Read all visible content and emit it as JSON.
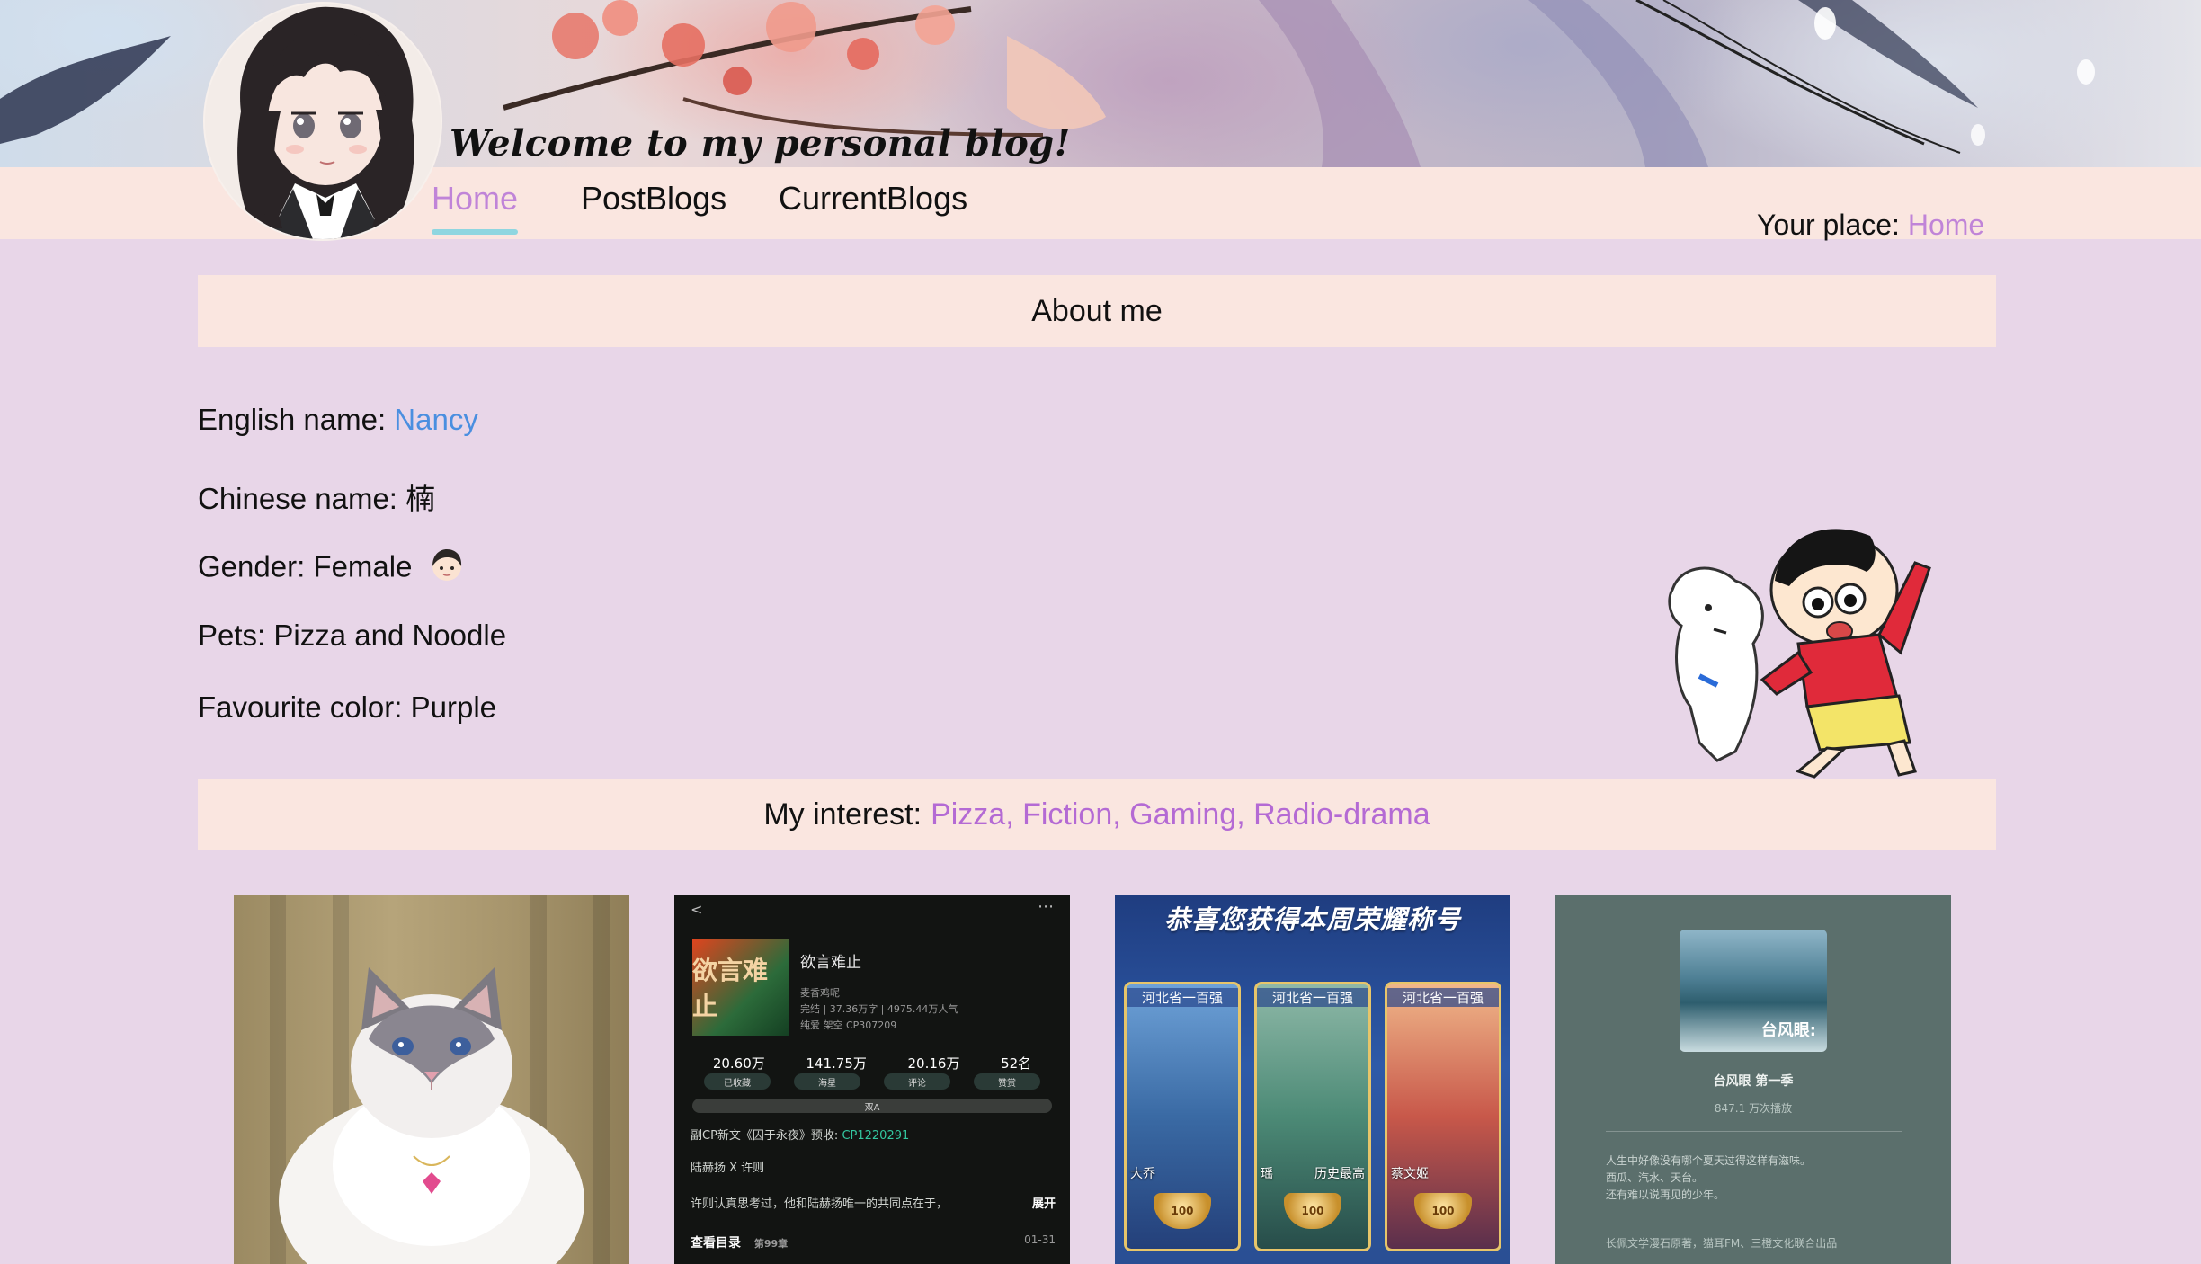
{
  "header": {
    "welcome": "Welcome to my personal blog!"
  },
  "nav": {
    "items": [
      {
        "label": "Home",
        "active": true
      },
      {
        "label": "PostBlogs",
        "active": false
      },
      {
        "label": "CurrentBlogs",
        "active": false
      }
    ],
    "your_place_label": "Your place:",
    "your_place_value": "Home"
  },
  "about": {
    "heading": "About me",
    "fields": [
      {
        "label": "English name:",
        "value": "Nancy"
      },
      {
        "label": "Chinese name:",
        "value": "楠"
      },
      {
        "label": "Gender:",
        "value": "Female"
      },
      {
        "label": "Pets:",
        "value": "Pizza and Noodle"
      },
      {
        "label": "Favourite color:",
        "value": "Purple"
      }
    ]
  },
  "interest": {
    "label": "My interest:",
    "values": "Pizza, Fiction, Gaming, Radio-drama"
  },
  "photos": {
    "novel": {
      "cover_text": "欲言难止",
      "title": "欲言难止",
      "author": "麦香鸡呢",
      "stats1": "完结 | 37.36万字 | 4975.44万人气",
      "stats2": "纯爱 架空 CP307209",
      "nums": [
        "20.60万",
        "141.75万",
        "20.16万",
        "52名"
      ],
      "pills": [
        "已收藏",
        "海星",
        "评论",
        "赞赏"
      ],
      "bar": "双A",
      "line1_prefix": "副CP新文《囚于永夜》预收:",
      "line1_cp": "CP1220291",
      "line2": "陆赫扬 X 许则",
      "line3": "许则认真思考过，他和陆赫扬唯一的共同点在于，",
      "more": "展开",
      "toc": "查看目录",
      "toc_sub": "第99章",
      "date": "01-31",
      "top_left": "<",
      "top_right": "⋯"
    },
    "gaming": {
      "title": "恭喜您获得本周荣耀称号",
      "cards": [
        {
          "label": "河北省一百强",
          "name": "大乔",
          "extra": ""
        },
        {
          "label": "河北省一百强",
          "name": "瑶",
          "extra": "历史最高"
        },
        {
          "label": "河北省一百强",
          "name": "蔡文姬",
          "extra": ""
        }
      ],
      "badge": "100"
    },
    "radio": {
      "cover_text": "台风眼:",
      "title": "台风眼 第一季",
      "plays": "847.1 万次播放",
      "desc_line1": "人生中好像没有哪个夏天过得这样有滋味。",
      "desc_line2": "西瓜、汽水、天台。",
      "desc_line3": "还有难以说再见的少年。",
      "credit": "长佩文学漫石原著，猫耳FM、三橙文化联合出品"
    }
  },
  "colors": {
    "page_bg": "#e8d6e8",
    "bar_bg": "#fae6e0",
    "accent_purple": "#c084d8",
    "accent_blue": "#4a8fe0",
    "underline": "#8fd6e0"
  }
}
